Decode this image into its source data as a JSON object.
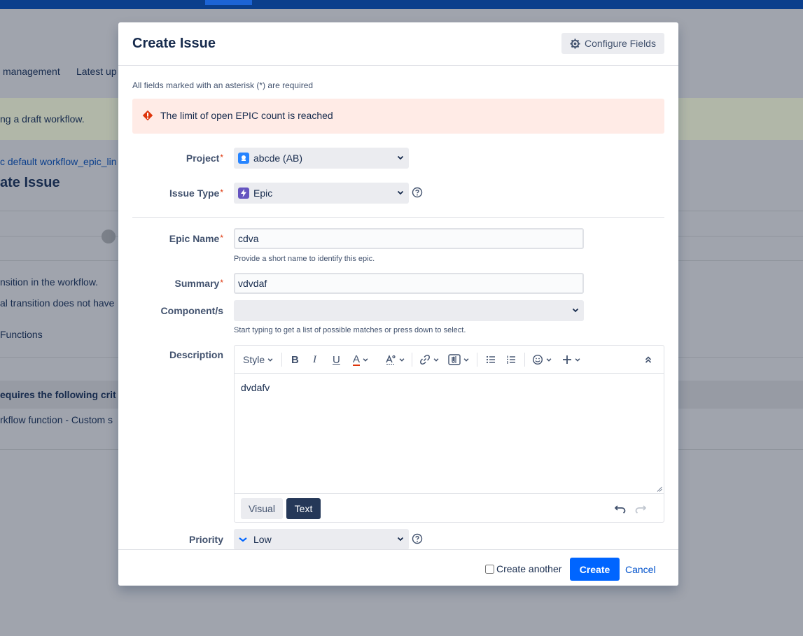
{
  "background": {
    "nav_management": "management",
    "nav_latest": "Latest up",
    "banner_text": "ng a draft workflow.",
    "breadcrumb": "c default workflow_epic_lin",
    "page_title": "ate Issue",
    "transition_text": "nsition in the workflow.",
    "transition_text2": "al transition does not have",
    "functions_label": "Functions",
    "criteria_text": "equires the following crit",
    "workflow_function": "rkflow function - Custom s"
  },
  "dialog": {
    "title": "Create Issue",
    "configure_fields": "Configure Fields",
    "required_note": "All fields marked with an asterisk (*) are required",
    "error_message": "The limit of open EPIC count is reached",
    "required_marker": "*"
  },
  "fields": {
    "project": {
      "label": "Project",
      "value": "abcde (AB)"
    },
    "issue_type": {
      "label": "Issue Type",
      "value": "Epic"
    },
    "epic_name": {
      "label": "Epic Name",
      "value": "cdva",
      "hint": "Provide a short name to identify this epic."
    },
    "summary": {
      "label": "Summary",
      "value": "vdvdaf"
    },
    "components": {
      "label": "Component/s",
      "value": "",
      "hint": "Start typing to get a list of possible matches or press down to select."
    },
    "description": {
      "label": "Description",
      "value": "dvdafv"
    },
    "priority": {
      "label": "Priority",
      "value": "Low"
    }
  },
  "editor": {
    "style_label": "Style",
    "bold_label": "B",
    "italic_label": "I",
    "underline_label": "U",
    "color_label": "A",
    "visual_tab": "Visual",
    "text_tab": "Text"
  },
  "footer": {
    "create_another": "Create another",
    "create": "Create",
    "cancel": "Cancel"
  },
  "colors": {
    "primary": "#0065ff",
    "error_bg": "#ffebe6",
    "error_icon": "#de350b",
    "epic": "#6554c0",
    "low_priority": "#0065ff"
  }
}
